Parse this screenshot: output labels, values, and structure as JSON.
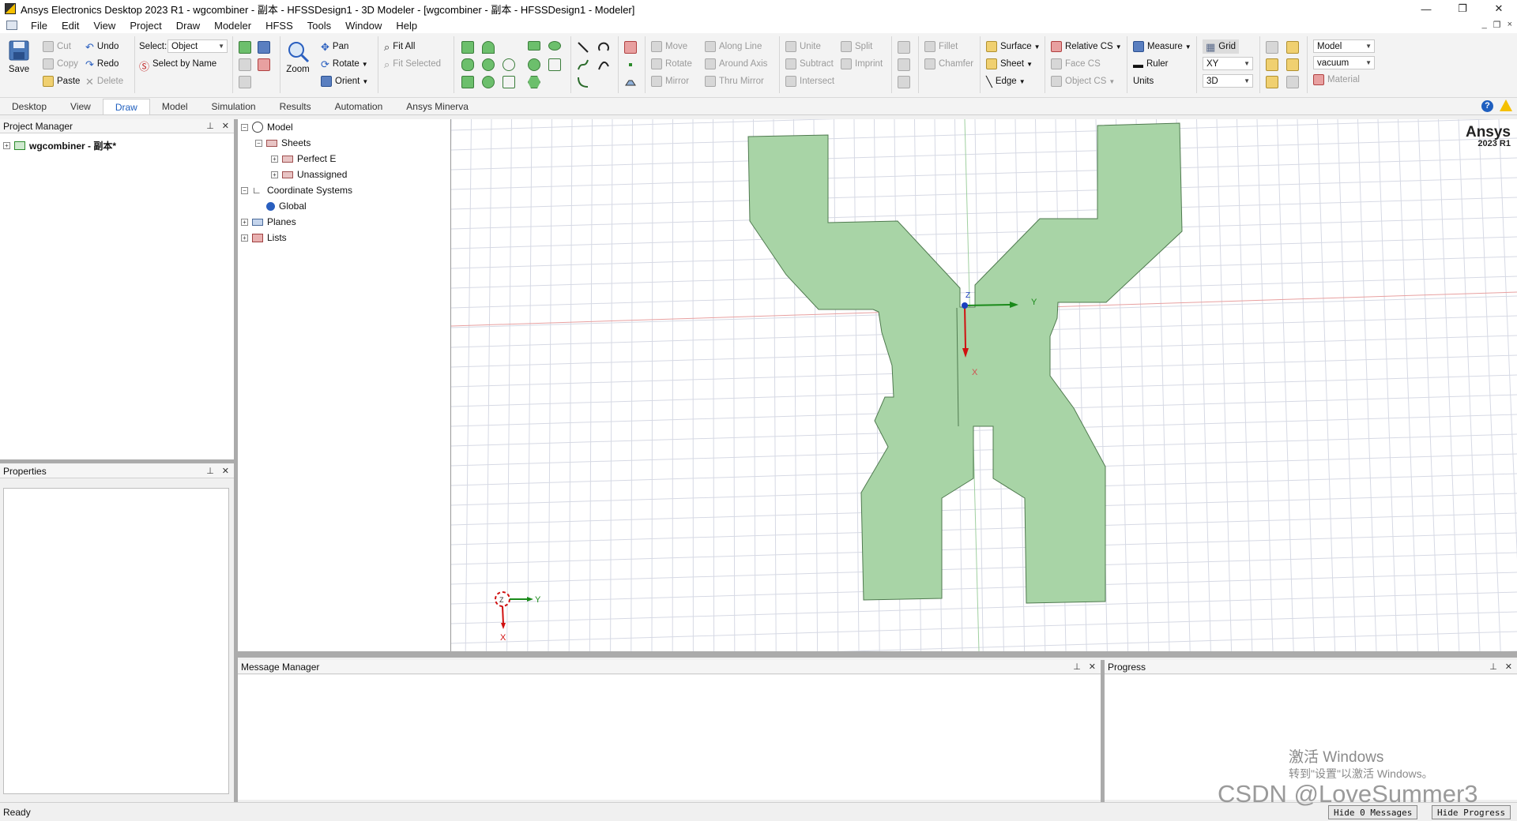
{
  "window": {
    "title": "Ansys Electronics Desktop 2023 R1 - wgcombiner - 副本 - HFSSDesign1 - 3D Modeler - [wgcombiner - 副本 - HFSSDesign1 - Modeler]",
    "minimize": "—",
    "restore": "❐",
    "close": "✕"
  },
  "menubar": {
    "items": [
      "File",
      "Edit",
      "View",
      "Project",
      "Draw",
      "Modeler",
      "HFSS",
      "Tools",
      "Window",
      "Help"
    ],
    "mdi_min": "_",
    "mdi_restore": "❐",
    "mdi_close": "×"
  },
  "ribbon": {
    "save": "Save",
    "cut": "Cut",
    "copy": "Copy",
    "paste": "Paste",
    "undo": "Undo",
    "redo": "Redo",
    "delete": "Delete",
    "select_label": "Select:",
    "select_value": "Object",
    "select_by_name": "Select by Name",
    "zoom": "Zoom",
    "pan": "Pan",
    "rotate": "Rotate",
    "orient": "Orient",
    "fit_all": "Fit All",
    "fit_selected": "Fit Selected",
    "move": "Move",
    "rotate2": "Rotate",
    "mirror": "Mirror",
    "along_line": "Along Line",
    "around_axis": "Around Axis",
    "thru_mirror": "Thru Mirror",
    "unite": "Unite",
    "subtract": "Subtract",
    "intersect": "Intersect",
    "split": "Split",
    "imprint": "Imprint",
    "fillet": "Fillet",
    "chamfer": "Chamfer",
    "surface": "Surface",
    "sheet": "Sheet",
    "edge": "Edge",
    "relative_cs": "Relative CS",
    "face_cs": "Face CS",
    "object_cs": "Object CS",
    "measure": "Measure",
    "ruler": "Ruler",
    "units": "Units",
    "grid": "Grid",
    "grid_plane": "XY",
    "grid_mode": "3D",
    "model_combo": "Model",
    "material_combo": "vacuum",
    "material": "Material"
  },
  "tabs": {
    "items": [
      "Desktop",
      "View",
      "Draw",
      "Model",
      "Simulation",
      "Results",
      "Automation",
      "Ansys Minerva"
    ],
    "active": "Draw",
    "help": "?"
  },
  "project_manager": {
    "title": "Project Manager",
    "project": "wgcombiner - 副本*"
  },
  "properties": {
    "title": "Properties"
  },
  "model_tree": {
    "model": "Model",
    "sheets": "Sheets",
    "perfect_e": "Perfect E",
    "unassigned": "Unassigned",
    "coord_systems": "Coordinate Systems",
    "global": "Global",
    "planes": "Planes",
    "lists": "Lists"
  },
  "viewport": {
    "brand": "Ansys",
    "version": "2023 R1",
    "axis_x": "X",
    "axis_y": "Y",
    "axis_z": "Z",
    "shape_color": "#a8d4a6",
    "shape_stroke": "#4f7a4f"
  },
  "message_manager": {
    "title": "Message Manager"
  },
  "progress": {
    "title": "Progress"
  },
  "status": {
    "text": "Ready",
    "hide_messages": "Hide 0 Messages",
    "hide_progress": "Hide Progress"
  },
  "watermarks": {
    "windows_line1": "激活 Windows",
    "windows_line2": "转到\"设置\"以激活 Windows。",
    "csdn": "CSDN @LoveSummer3"
  }
}
